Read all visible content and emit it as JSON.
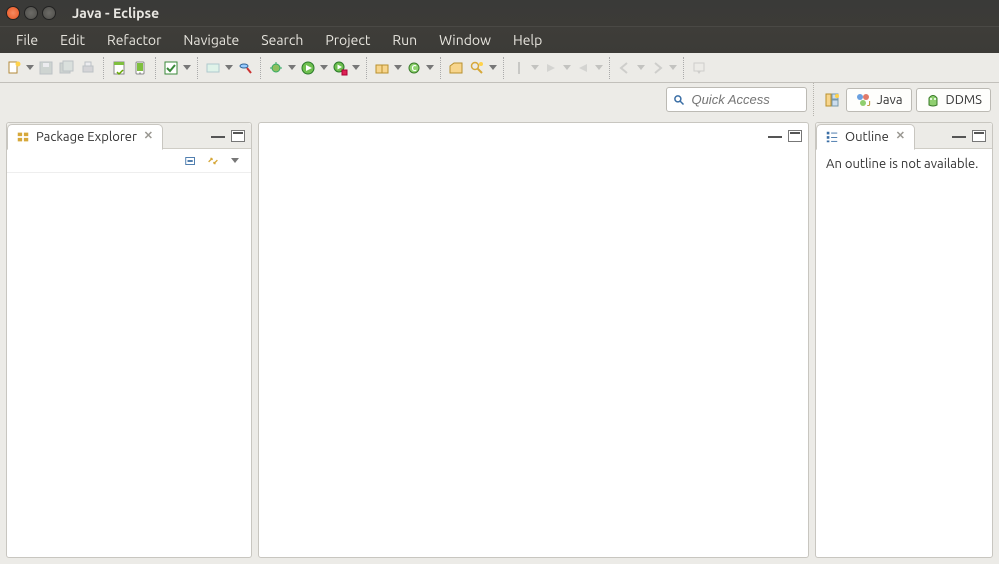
{
  "window": {
    "title": "Java - Eclipse"
  },
  "menu": {
    "items": [
      "File",
      "Edit",
      "Refactor",
      "Navigate",
      "Search",
      "Project",
      "Run",
      "Window",
      "Help"
    ]
  },
  "quickaccess": {
    "placeholder": "Quick Access"
  },
  "perspectives": {
    "java_label": "Java",
    "ddms_label": "DDMS"
  },
  "views": {
    "package_explorer": {
      "title": "Package Explorer"
    },
    "outline": {
      "title": "Outline",
      "empty_text": "An outline is not available."
    }
  }
}
